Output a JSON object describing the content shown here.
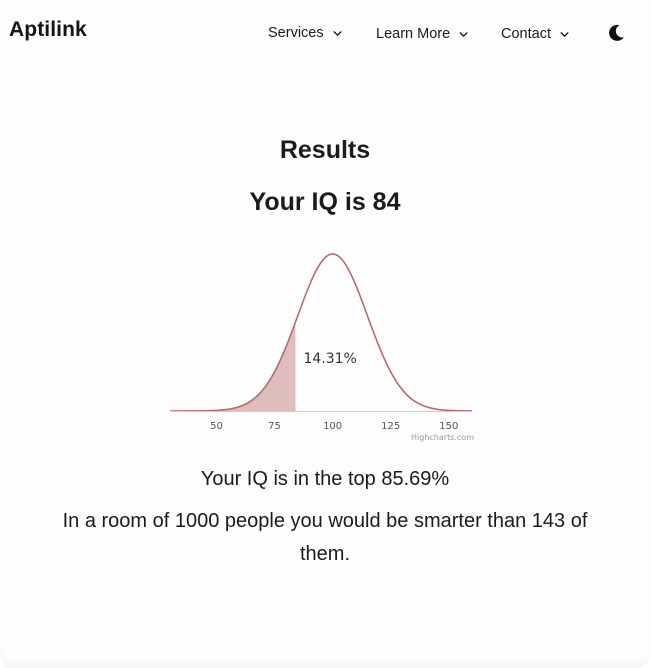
{
  "header": {
    "brand": "Aptilink",
    "nav": [
      {
        "label": "Services"
      },
      {
        "label": "Learn More"
      },
      {
        "label": "Contact"
      }
    ],
    "theme_icon": "moon-icon"
  },
  "results": {
    "title": "Results",
    "iq_heading": "Your IQ is 84",
    "summary": "Your IQ is in the top 85.69%",
    "room_text": "In a room of 1000 people you would be smarter than 143 of them."
  },
  "chart_data": {
    "type": "area",
    "distribution": "normal",
    "mean": 100,
    "sd": 15,
    "xlim": [
      30,
      160
    ],
    "x_ticks": [
      50,
      75,
      100,
      125,
      150
    ],
    "shaded_upto": 84,
    "shaded_label": "14.31%",
    "credit": "Highcharts.com",
    "colors": {
      "curve": "#b86b6b",
      "fill": "#d8b1b1",
      "axis": "#cccccc"
    }
  }
}
